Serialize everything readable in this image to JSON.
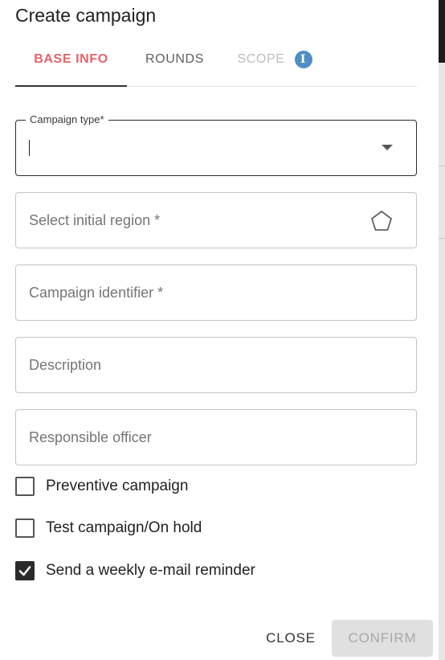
{
  "dialog": {
    "title": "Create campaign"
  },
  "tabs": [
    {
      "label": "BASE INFO",
      "state": "active"
    },
    {
      "label": "ROUNDS",
      "state": "normal"
    },
    {
      "label": "SCOPE",
      "state": "disabled",
      "icon": "info-icon"
    }
  ],
  "fields": {
    "campaign_type": {
      "label": "Campaign type*",
      "value": ""
    },
    "initial_region": {
      "placeholder": "Select initial region *",
      "icon": "polygon-icon"
    },
    "campaign_identifier": {
      "placeholder": "Campaign identifier *"
    },
    "description": {
      "placeholder": "Description"
    },
    "responsible_officer": {
      "placeholder": "Responsible officer"
    }
  },
  "checkboxes": [
    {
      "label": "Preventive campaign",
      "checked": false
    },
    {
      "label": "Test campaign/On hold",
      "checked": false
    },
    {
      "label": "Send a weekly e-mail reminder",
      "checked": true
    }
  ],
  "actions": {
    "close_label": "CLOSE",
    "confirm_label": "CONFIRM",
    "confirm_disabled": true
  },
  "colors": {
    "accent": "#e2646a",
    "info": "#4f8dc2",
    "disabled_text": "#bdbdbd"
  }
}
